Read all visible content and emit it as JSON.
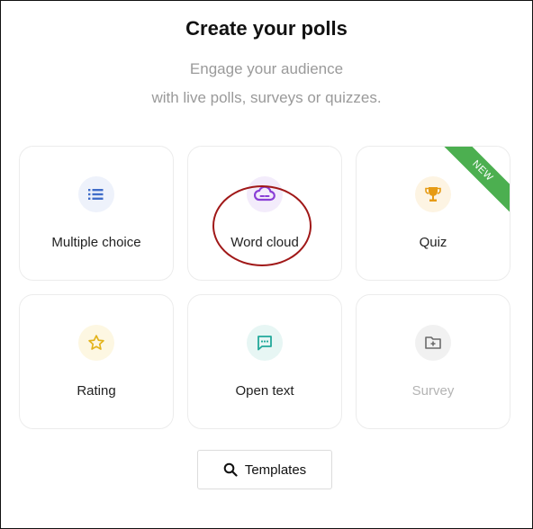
{
  "header": {
    "title": "Create your polls",
    "subtitle_line1": "Engage your audience",
    "subtitle_line2": "with live polls, surveys or quizzes."
  },
  "cards": [
    {
      "label": "Multiple choice",
      "icon": "list-icon",
      "icon_color": "#3f6cc9",
      "icon_bg": "#eef2fb"
    },
    {
      "label": "Word cloud",
      "icon": "cloud-icon",
      "icon_color": "#8a3fd6",
      "icon_bg": "#f3ecfb"
    },
    {
      "label": "Quiz",
      "icon": "trophy-icon",
      "icon_color": "#e69b15",
      "icon_bg": "#fdf4e3",
      "badge": "NEW",
      "badge_color": "#4caf50"
    },
    {
      "label": "Rating",
      "icon": "star-icon",
      "icon_color": "#e3b31b",
      "icon_bg": "#fdf7e2"
    },
    {
      "label": "Open text",
      "icon": "chat-icon",
      "icon_color": "#22a99a",
      "icon_bg": "#e7f6f4"
    },
    {
      "label": "Survey",
      "icon": "folder-plus-icon",
      "icon_color": "#6b6b6b",
      "icon_bg": "#f1f1f1",
      "disabled": true
    }
  ],
  "templates_button": {
    "label": "Templates",
    "icon": "search-icon"
  },
  "annotation": {
    "highlight_color": "#a01818"
  }
}
